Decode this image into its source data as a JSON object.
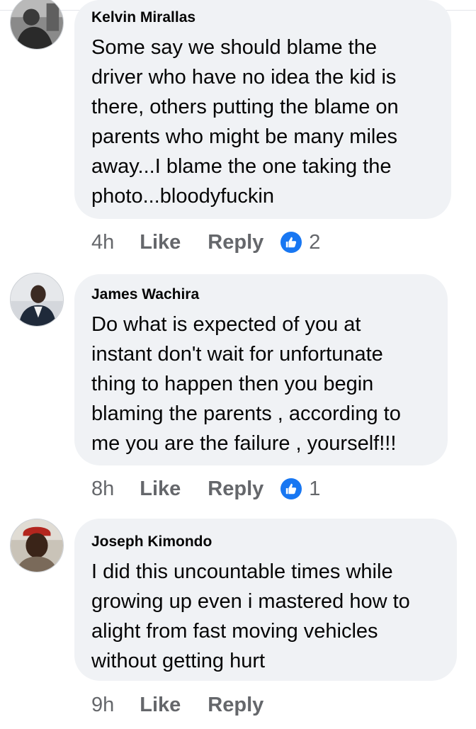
{
  "comments": [
    {
      "author": "Kelvin Mirallas",
      "text": "Some say we should blame the\ndriver who have no idea the kid is\nthere, others putting the blame on\nparents who might be  many miles\naway...I blame the one taking the\nphoto...bloodyfuckin",
      "time": "4h",
      "like_label": "Like",
      "reply_label": "Reply",
      "reaction_icon": "like-thumb-icon",
      "reaction_count": "2"
    },
    {
      "author": "James Wachira",
      "text": "Do what is expected of you at\ninstant don't wait for unfortunate\nthing to happen then you begin\nblaming the parents , according to\nme you are the failure , yourself!!!",
      "time": "8h",
      "like_label": "Like",
      "reply_label": "Reply",
      "reaction_icon": "like-thumb-icon",
      "reaction_count": "1"
    },
    {
      "author": "Joseph Kimondo",
      "text": "I did this uncountable times while\ngrowing up even i mastered how to\nalight from fast moving vehicles\nwithout getting hurt",
      "time": "9h",
      "like_label": "Like",
      "reply_label": "Reply"
    }
  ],
  "colors": {
    "bubble_bg": "#f0f2f5",
    "meta_text": "#65676b",
    "like_blue": "#1877f2",
    "body_text": "#050505"
  }
}
